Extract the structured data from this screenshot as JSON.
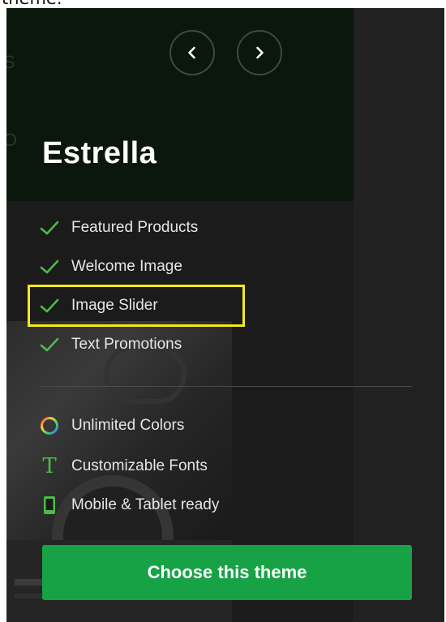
{
  "caption": "theme.",
  "hero": {
    "ghost_letters": [
      "S",
      "O"
    ],
    "prev_icon": "chevron-left-icon",
    "next_icon": "chevron-right-icon",
    "theme_name": "Estrella"
  },
  "features": [
    {
      "label": "Featured Products",
      "icon": "checkmark-icon"
    },
    {
      "label": "Welcome Image",
      "icon": "checkmark-icon"
    },
    {
      "label": "Image Slider",
      "icon": "checkmark-icon",
      "highlighted": true
    },
    {
      "label": "Text Promotions",
      "icon": "checkmark-icon"
    }
  ],
  "extras": [
    {
      "label": "Unlimited Colors",
      "icon": "color-ring-icon"
    },
    {
      "label": "Customizable Fonts",
      "icon": "font-t-icon"
    },
    {
      "label": "Mobile & Tablet ready",
      "icon": "mobile-device-icon"
    }
  ],
  "cta": {
    "label": "Choose this theme"
  },
  "colors": {
    "accent_green": "#17a245",
    "check_green": "#4cbb4a",
    "highlight_yellow": "#f2ea1c",
    "panel_bg": "#1b1b1b"
  }
}
